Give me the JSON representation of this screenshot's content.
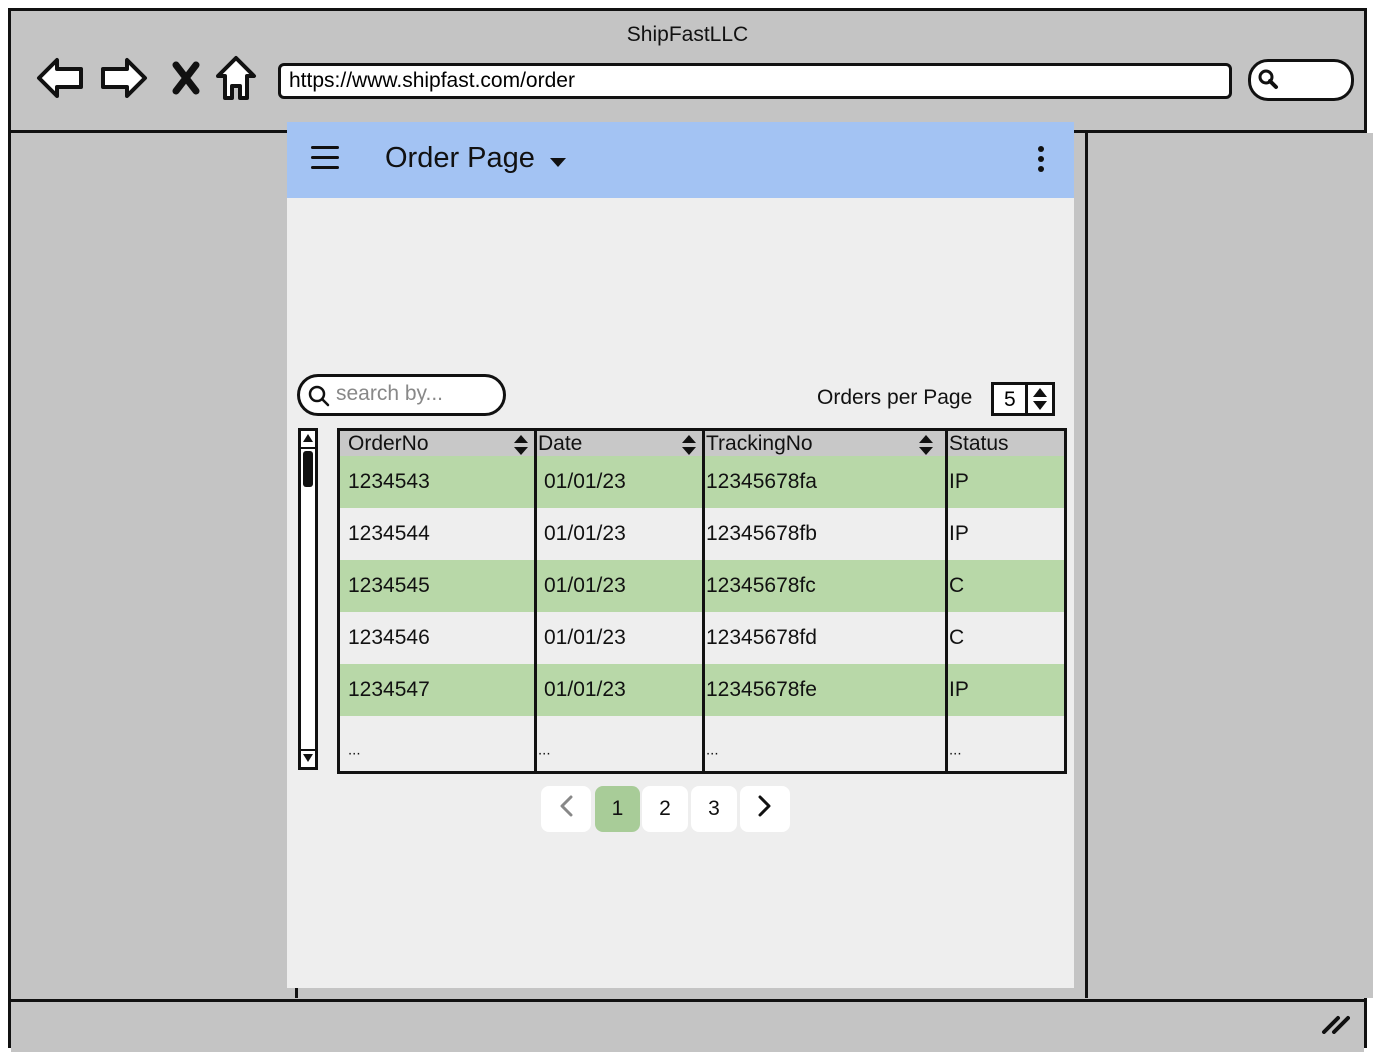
{
  "browser": {
    "title": "ShipFastLLC",
    "url": "https://www.shipfast.com/order"
  },
  "app": {
    "title": "Order Page",
    "menu_icon": "hamburger-icon",
    "more_icon": "kebab-icon"
  },
  "search": {
    "placeholder": "search by..."
  },
  "orders_per_page": {
    "label": "Orders per Page",
    "value": "5"
  },
  "table": {
    "columns": [
      "OrderNo",
      "Date",
      "TrackingNo",
      "Status"
    ],
    "rows": [
      [
        "1234543",
        "01/01/23",
        "12345678fa",
        "IP"
      ],
      [
        "1234544",
        "01/01/23",
        "12345678fb",
        "IP"
      ],
      [
        "1234545",
        "01/01/23",
        "12345678fc",
        "C"
      ],
      [
        "1234546",
        "01/01/23",
        "12345678fd",
        "C"
      ],
      [
        "1234547",
        "01/01/23",
        "12345678fe",
        "IP"
      ],
      [
        "...",
        "...",
        "...",
        "..."
      ]
    ]
  },
  "pagination": {
    "pages": [
      "1",
      "2",
      "3"
    ],
    "active": "1"
  },
  "colors": {
    "appbar": "#a3c3f3",
    "row_highlight": "#b8d8a8",
    "active_page": "#a8cc98"
  }
}
